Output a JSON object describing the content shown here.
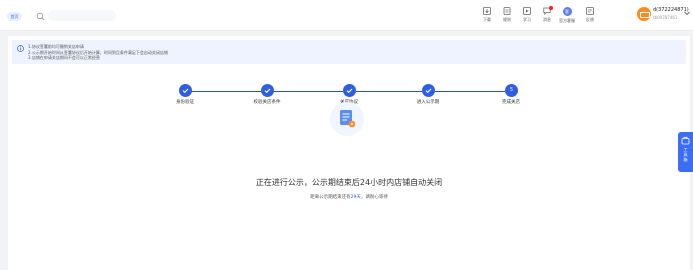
{
  "header": {
    "home_label": "首页",
    "search_placeholder": "",
    "tools": [
      {
        "label": "下载",
        "icon": "download-icon"
      },
      {
        "label": "规则",
        "icon": "rule-book-icon"
      },
      {
        "label": "学习",
        "icon": "study-icon"
      },
      {
        "label": "消息",
        "icon": "message-icon"
      },
      {
        "label": "官方客服",
        "icon": "service-icon"
      },
      {
        "label": "反馈",
        "icon": "feedback-icon"
      }
    ],
    "service_badge": "客",
    "user": {
      "name": "d(372224871)",
      "sub": "tb00787461"
    }
  },
  "notice": {
    "lines": [
      "1.协议签署前均可撤销关店申请",
      "2.公示期开始时间从签署协议后开始计算，时间到且条件满足下会自动关闭店铺",
      "3.店铺在申请关店期间不会可以正常经营"
    ]
  },
  "steps": [
    {
      "label": "身份验证",
      "state": "done"
    },
    {
      "label": "校验关店条件",
      "state": "done"
    },
    {
      "label": "关店协议",
      "state": "done"
    },
    {
      "label": "进入公示期",
      "state": "done"
    },
    {
      "label": "完成关店",
      "state": "current",
      "number": "5"
    }
  ],
  "status": {
    "title": "正在进行公示，公示期结束后24小时内店铺自动关闭",
    "sub_prefix": "距离公示期结束还有",
    "sub_highlight": "29天",
    "sub_suffix": "，请耐心等待"
  },
  "side_tool": {
    "label": "工具箱"
  },
  "colors": {
    "primary": "#2f5ee0",
    "accent_orange": "#ff8a1f",
    "notice_bg": "#eef3ff"
  }
}
